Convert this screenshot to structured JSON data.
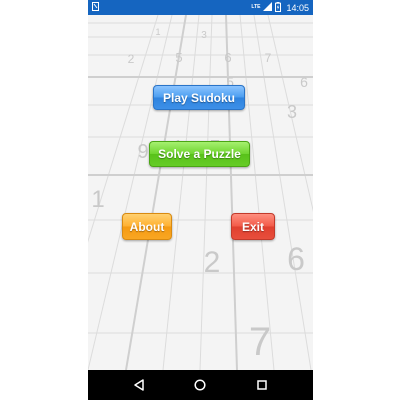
{
  "status_bar": {
    "time": "14:05",
    "network": "LTE",
    "icons": [
      "notification-icon",
      "lte-icon",
      "signal-icon",
      "battery-icon"
    ]
  },
  "background_digits": [
    "1",
    "3",
    "5",
    "6",
    "7",
    "2",
    "3",
    "5",
    "6",
    "3",
    "9",
    "1",
    "7",
    "1",
    "2",
    "6",
    "7"
  ],
  "menu": {
    "play_label": "Play Sudoku",
    "solve_label": "Solve a Puzzle",
    "about_label": "About",
    "exit_label": "Exit"
  },
  "nav_bar": {
    "icons": [
      "back-icon",
      "home-icon",
      "recents-icon"
    ]
  },
  "colors": {
    "status_bar": "#1565c0",
    "play_button": "#3d90e8",
    "solve_button": "#66cc26",
    "about_button": "#f9a622",
    "exit_button": "#e84e3c",
    "nav_bar": "#000000"
  }
}
